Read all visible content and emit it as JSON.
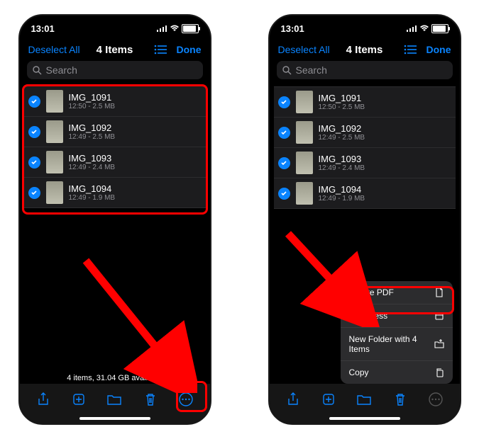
{
  "status": {
    "time": "13:01"
  },
  "nav": {
    "deselect": "Deselect All",
    "title": "4 Items",
    "done": "Done"
  },
  "search": {
    "placeholder": "Search"
  },
  "files": [
    {
      "name": "IMG_1091",
      "meta": "12:50 - 2.5 MB"
    },
    {
      "name": "IMG_1092",
      "meta": "12:49 - 2.5 MB"
    },
    {
      "name": "IMG_1093",
      "meta": "12:49 - 2.4 MB"
    },
    {
      "name": "IMG_1094",
      "meta": "12:49 - 1.9 MB"
    }
  ],
  "footer": {
    "status": "4 items, 31.04 GB available"
  },
  "menu": {
    "create_pdf": "Create PDF",
    "compress": "Compress",
    "new_folder": "New Folder with 4 Items",
    "copy": "Copy"
  }
}
